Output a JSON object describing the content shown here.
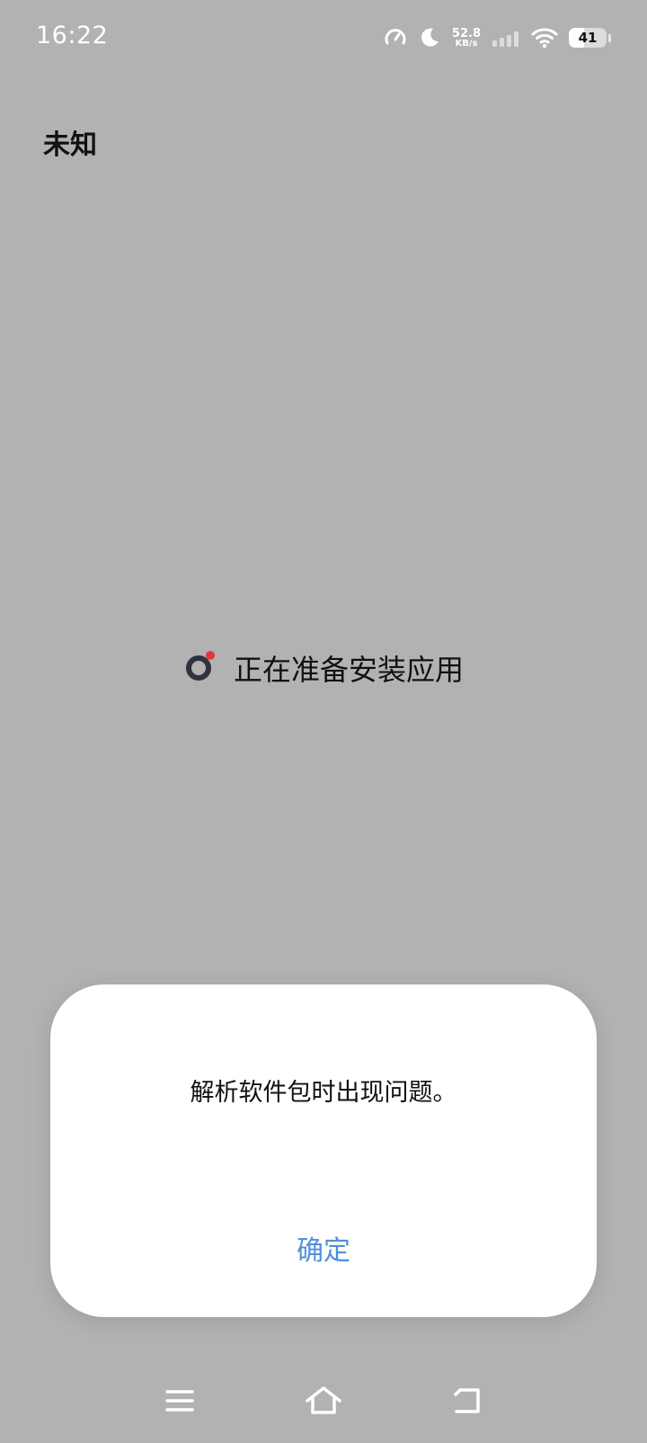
{
  "status_bar": {
    "time": "16:22",
    "net_speed_value": "52.8",
    "net_speed_unit": "KB/s",
    "battery_level": "41",
    "icons": [
      "speedometer-icon",
      "moon-icon",
      "signal-icon",
      "wifi-icon",
      "battery-icon"
    ]
  },
  "page": {
    "title": "未知"
  },
  "loading": {
    "text": "正在准备安装应用",
    "spinner_colors": {
      "ring": "#2e3140",
      "dot": "#e0383e"
    }
  },
  "dialog": {
    "message": "解析软件包时出现问题。",
    "ok_label": "确定",
    "ok_color": "#4f8fdc"
  },
  "nav_bar": {
    "icons": [
      "menu-icon",
      "home-icon",
      "back-icon"
    ]
  }
}
